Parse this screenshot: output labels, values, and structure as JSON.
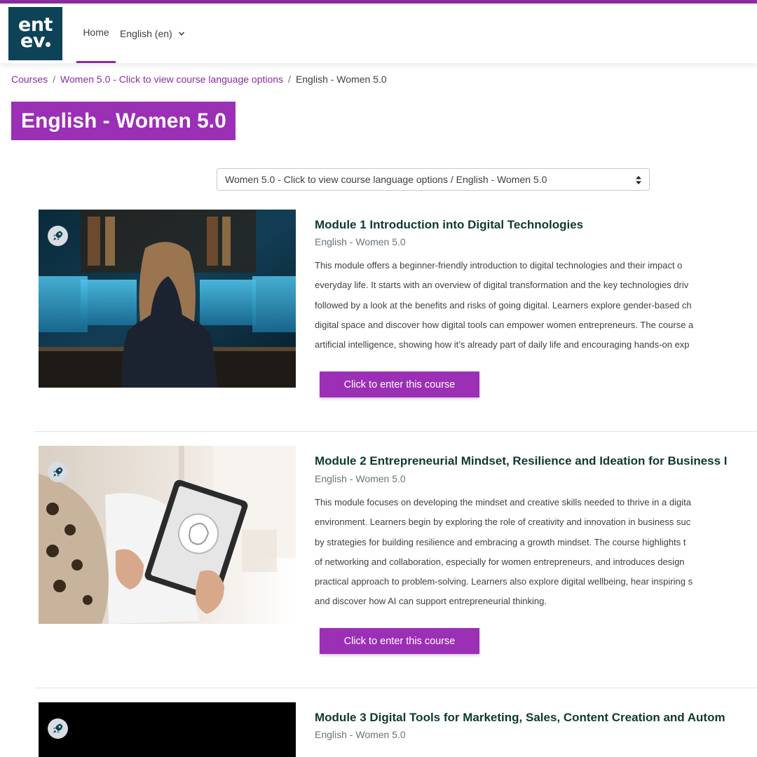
{
  "brand": {
    "logo_line1": "ent",
    "logo_line2": "ev",
    "accent_color": "#9b2fb5",
    "logo_bg": "#0d4257"
  },
  "nav": {
    "home_label": "Home",
    "language_label": "English (en)"
  },
  "breadcrumb": {
    "items": [
      "Courses",
      "Women 5.0 - Click to view course language options",
      "English - Women 5.0"
    ],
    "separator": "/"
  },
  "page": {
    "title": "English - Women 5.0"
  },
  "course_select": {
    "value": "Women 5.0 - Click to view course language options / English - Women 5.0"
  },
  "courses": [
    {
      "title": "Module 1 Introduction into Digital Technologies",
      "subtitle": "English - Women 5.0",
      "description_lines": [
        "This module offers a beginner-friendly introduction to digital technologies and their impact o",
        "everyday life. It starts with an overview of digital transformation and the key technologies driv",
        "followed by a look at the benefits and risks of going digital. Learners explore gender-based ch",
        "digital space and discover how digital tools can empower women entrepreneurs. The course a",
        "artificial intelligence, showing how it’s already part of daily life and encouraging hands-on exp"
      ],
      "button_label": "Click to enter this course",
      "badge_icon": "rocket-icon"
    },
    {
      "title": "Module 2 Entrepreneurial Mindset, Resilience and Ideation for Business I",
      "subtitle": "English - Women 5.0",
      "description_lines": [
        "This module focuses on developing the mindset and creative skills needed to thrive in a digita",
        "environment. Learners begin by exploring the role of creativity and innovation in business suc",
        "by strategies for building resilience and embracing a growth mindset. The course highlights t",
        "of networking and collaboration, especially for women entrepreneurs, and introduces design",
        "practical approach to problem-solving. Learners also explore digital wellbeing, hear inspiring s",
        "and discover how AI can support entrepreneurial thinking."
      ],
      "button_label": "Click to enter this course",
      "badge_icon": "rocket-icon"
    },
    {
      "title": "Module 3 Digital Tools for Marketing, Sales, Content Creation and Autom",
      "subtitle": "English - Women 5.0",
      "description_lines": [],
      "button_label": "",
      "badge_icon": "rocket-icon"
    }
  ]
}
